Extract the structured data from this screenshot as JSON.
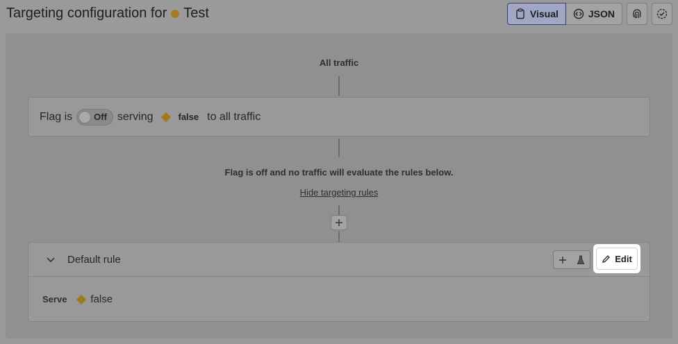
{
  "header": {
    "title_prefix": "Targeting configuration for",
    "flag_name": "Test",
    "view_buttons": {
      "visual": "Visual",
      "json": "JSON"
    }
  },
  "flow": {
    "all_traffic": "All traffic",
    "flag_card": {
      "prefix": "Flag is",
      "toggle_label": "Off",
      "serving": "serving",
      "variation": "false",
      "suffix": "to all traffic"
    },
    "off_message": "Flag is off and no traffic will evaluate the rules below.",
    "hide_link": "Hide targeting rules"
  },
  "default_rule": {
    "title": "Default rule",
    "edit_label": "Edit",
    "serve_label": "Serve",
    "serve_value": "false"
  },
  "colors": {
    "variation": "#c89b24",
    "highlight": "#ffffff",
    "active_border": "#3b3f6e"
  },
  "icons": [
    "clipboard-icon",
    "code-icon",
    "fingerprint-icon",
    "check-circle-icon",
    "chevron-down-icon",
    "plus-icon",
    "flask-icon",
    "pencil-icon"
  ]
}
